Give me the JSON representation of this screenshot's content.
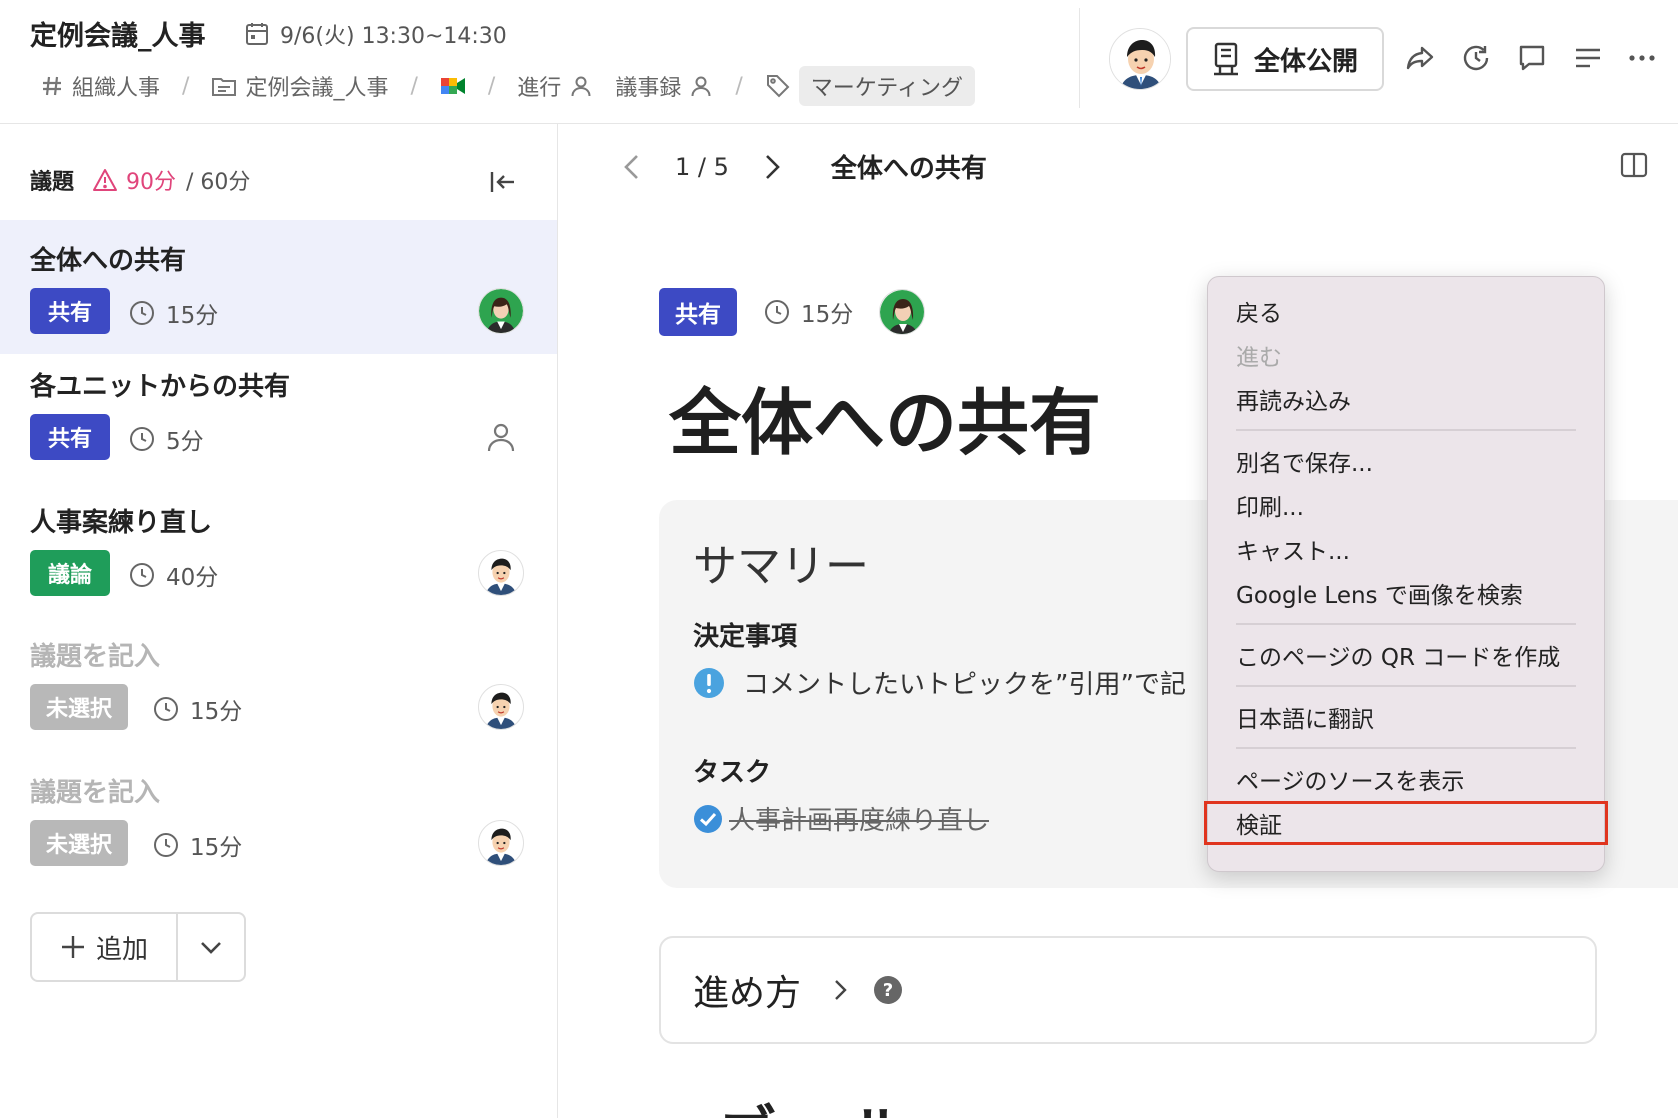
{
  "header": {
    "title": "定例会議_人事",
    "datetime": "9/6(火) 13:30~14:30",
    "breadcrumbs": {
      "channel": "組織人事",
      "folder": "定例会議_人事",
      "facilitator_label": "進行",
      "minutes_label": "議事録",
      "tag": "マーケティング"
    },
    "visibility_button": "全体公開"
  },
  "sidebar": {
    "agenda_label": "議題",
    "total_time": "90分",
    "planned_time": "/ 60分",
    "topics": [
      {
        "title": "全体への共有",
        "badge": "共有",
        "duration": "15分"
      },
      {
        "title": "各ユニットからの共有",
        "badge": "共有",
        "duration": "5分"
      },
      {
        "title": "人事案練り直し",
        "badge": "議論",
        "duration": "40分"
      },
      {
        "title": "議題を記入",
        "badge": "未選択",
        "duration": "15分"
      },
      {
        "title": "議題を記入",
        "badge": "未選択",
        "duration": "15分"
      }
    ],
    "add_label": "追加"
  },
  "main": {
    "pager": {
      "position": "1 / 5",
      "current_title": "全体への共有"
    },
    "badge": "共有",
    "duration": "15分",
    "title": "全体への共有",
    "summary": {
      "title": "サマリー",
      "decisions_label": "決定事項",
      "decision_text": "コメントしたいトピックを”引用”で記",
      "tasks_label": "タスク",
      "task_text": "人事計画再度練り直し"
    },
    "howto_label": "進め方",
    "next_section_label": "ゴール"
  },
  "context_menu": {
    "items": [
      {
        "label": "戻る",
        "enabled": true
      },
      {
        "label": "進む",
        "enabled": false
      },
      {
        "label": "再読み込み",
        "enabled": true
      },
      {
        "label": "別名で保存...",
        "enabled": true
      },
      {
        "label": "印刷...",
        "enabled": true
      },
      {
        "label": "キャスト...",
        "enabled": true
      },
      {
        "label": "Google Lens で画像を検索",
        "enabled": true
      },
      {
        "label": "このページの QR コードを作成",
        "enabled": true
      },
      {
        "label": "日本語に翻訳",
        "enabled": true
      },
      {
        "label": "ページのソースを表示",
        "enabled": true
      },
      {
        "label": "検証",
        "enabled": true,
        "highlighted": true
      }
    ]
  },
  "colors": {
    "share_badge": "#3d4ac4",
    "discussion_badge": "#1f9d5a",
    "unselected_badge": "#b8b8b8",
    "warning": "#e0457b",
    "highlight_box": "#e0341e",
    "active_row": "#eef0fb"
  },
  "icons": [
    "calendar-icon",
    "hash-icon",
    "folder-doc-icon",
    "meet-icon",
    "person-icon",
    "tag-icon",
    "share-arrow-icon",
    "history-icon",
    "comment-icon",
    "list-icon",
    "more-icon",
    "warning-icon",
    "collapse-icon",
    "clock-icon",
    "plus-icon",
    "chevron-down-icon",
    "chevron-left-icon",
    "chevron-right-icon",
    "split-view-icon",
    "exclamation-icon",
    "check-circle-icon",
    "help-icon",
    "folder-icon"
  ]
}
